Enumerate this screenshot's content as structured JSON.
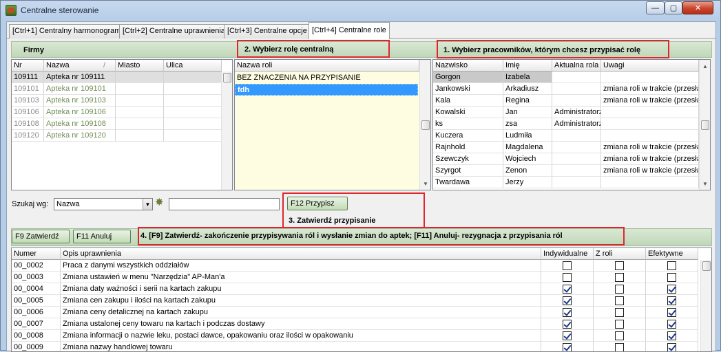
{
  "window": {
    "title": "Centralne sterowanie",
    "min_glyph": "—",
    "max_glyph": "▢",
    "close_glyph": "✕"
  },
  "tabs": [
    {
      "label": "[Ctrl+1] Centralny harmonogram",
      "active": false
    },
    {
      "label": "[Ctrl+2] Centralne uprawnienia",
      "active": false
    },
    {
      "label": "[Ctrl+3] Centralne opcje",
      "active": false
    },
    {
      "label": "[Ctrl+4] Centralne role",
      "active": true
    }
  ],
  "firms": {
    "header": "Firmy",
    "columns": [
      "Nr",
      "Nazwa",
      "Miasto",
      "Ulica"
    ],
    "sort_glyph": "/",
    "rows": [
      {
        "nr": "109111",
        "nazwa": "Apteka nr 109111",
        "miasto": "",
        "ulica": ""
      },
      {
        "nr": "109101",
        "nazwa": "Apteka nr 109101",
        "miasto": "",
        "ulica": ""
      },
      {
        "nr": "109103",
        "nazwa": "Apteka nr 109103",
        "miasto": "",
        "ulica": ""
      },
      {
        "nr": "109106",
        "nazwa": "Apteka nr 109106",
        "miasto": "",
        "ulica": ""
      },
      {
        "nr": "109108",
        "nazwa": "Apteka nr 109108",
        "miasto": "",
        "ulica": ""
      },
      {
        "nr": "109120",
        "nazwa": "Apteka nr 109120",
        "miasto": "",
        "ulica": ""
      }
    ]
  },
  "roles": {
    "step_label": "2. Wybierz rolę centralną",
    "column": "Nazwa roli",
    "items": [
      "BEZ ZNACZENIA NA PRZYPISANIE",
      "fdh"
    ]
  },
  "employees": {
    "step_label": "1. Wybierz pracowników, którym chcesz przypisać rolę",
    "columns": [
      "Nazwisko",
      "Imię",
      "Aktualna rola",
      "Uwagi"
    ],
    "rows": [
      {
        "nazwisko": "Gorgon",
        "imie": "Izabela",
        "rola": "",
        "uwagi": ""
      },
      {
        "nazwisko": "Jankowski",
        "imie": "Arkadiusz",
        "rola": "",
        "uwagi": "zmiana roli w trakcie (przesłar"
      },
      {
        "nazwisko": "Kala",
        "imie": "Regina",
        "rola": "",
        "uwagi": "zmiana roli w trakcie (przesłar"
      },
      {
        "nazwisko": "Kowalski",
        "imie": "Jan",
        "rola": "Administratorzy",
        "uwagi": ""
      },
      {
        "nazwisko": "ks",
        "imie": "zsa",
        "rola": "Administratorzy",
        "uwagi": ""
      },
      {
        "nazwisko": "Kuczera",
        "imie": "Ludmiła",
        "rola": "",
        "uwagi": ""
      },
      {
        "nazwisko": "Rajnhold",
        "imie": "Magdalena",
        "rola": "",
        "uwagi": "zmiana roli w trakcie (przesłar"
      },
      {
        "nazwisko": "Szewczyk",
        "imie": "Wojciech",
        "rola": "",
        "uwagi": "zmiana roli w trakcie (przesłar"
      },
      {
        "nazwisko": "Szyrgot",
        "imie": "Zenon",
        "rola": "",
        "uwagi": "zmiana roli w trakcie (przesłar"
      },
      {
        "nazwisko": "Twardawa",
        "imie": "Jerzy",
        "rola": "",
        "uwagi": ""
      }
    ]
  },
  "search": {
    "label": "Szukaj wg:",
    "field_value": "Nazwa",
    "text_value": ""
  },
  "assign": {
    "button_label": "F12 Przypisz",
    "step_label": "3. Zatwierdź przypisanie"
  },
  "confirm": {
    "approve_label": "F9 Zatwierdź",
    "cancel_label": "F11 Anuluj",
    "step_label": "4. [F9] Zatwierdź- zakończenie przypisywania ról i wysłanie zmian do aptek; [F11] Anuluj- rezygnacja z przypisania ról"
  },
  "permissions": {
    "columns": [
      "Numer",
      "Opis uprawnienia",
      "Indywidualne",
      "Z roli",
      "Efektywne"
    ],
    "rows": [
      {
        "numer": "00_0002",
        "opis": "Praca z danymi wszystkich oddziałów",
        "indywidualne": false,
        "z_roli": false,
        "efektywne": false
      },
      {
        "numer": "00_0003",
        "opis": "Zmiana ustawień w menu \"Narzędzia\" AP-Man'a",
        "indywidualne": false,
        "z_roli": false,
        "efektywne": false
      },
      {
        "numer": "00_0004",
        "opis": "Zmiana daty ważności i serii na kartach zakupu",
        "indywidualne": true,
        "z_roli": false,
        "efektywne": true
      },
      {
        "numer": "00_0005",
        "opis": "Zmiana cen zakupu i ilości na kartach zakupu",
        "indywidualne": true,
        "z_roli": false,
        "efektywne": true
      },
      {
        "numer": "00_0006",
        "opis": "Zmiana ceny detalicznej na kartach zakupu",
        "indywidualne": true,
        "z_roli": false,
        "efektywne": true
      },
      {
        "numer": "00_0007",
        "opis": "Zmiana ustalonej ceny towaru na kartach i podczas dostawy",
        "indywidualne": true,
        "z_roli": false,
        "efektywne": true
      },
      {
        "numer": "00_0008",
        "opis": "Zmiana informacji o nazwie leku, postaci dawce, opakowaniu oraz ilości w opakowaniu",
        "indywidualne": true,
        "z_roli": false,
        "efektywne": true
      },
      {
        "numer": "00_0009",
        "opis": "Zmiana nazwy handlowej towaru",
        "indywidualne": true,
        "z_roli": false,
        "efektywne": true
      }
    ]
  },
  "icons": {
    "sort": "sort-indicator-icon",
    "search_action": "search-gear-icon",
    "scroll_up": "scroll-up-icon",
    "scroll_down": "scroll-down-icon",
    "scroll_up_glyph": "▲",
    "scroll_down_glyph": "▼",
    "gear_glyph": "✸"
  },
  "colors": {
    "selection_blue": "#3399ff",
    "highlight_red": "#e0262c",
    "header_green": "#c0d7b8",
    "roles_bg": "#fffde1"
  }
}
